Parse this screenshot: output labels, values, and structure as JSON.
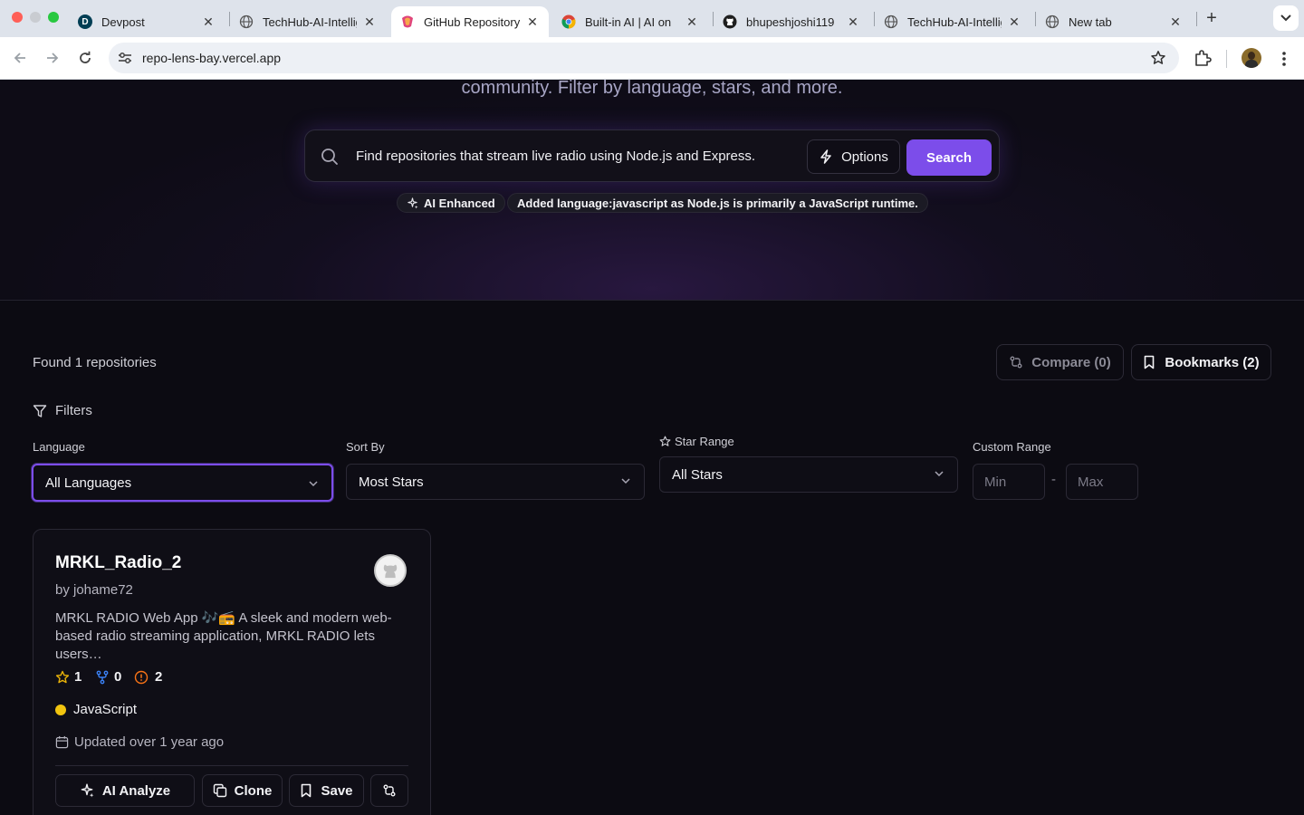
{
  "browser": {
    "tabs": [
      {
        "title": "Devpost",
        "favicon": "devpost-icon"
      },
      {
        "title": "TechHub-AI-Intellig",
        "favicon": "globe-icon"
      },
      {
        "title": "GitHub Repository",
        "favicon": "app-icon",
        "active": true
      },
      {
        "title": "Built-in AI  |  AI on",
        "favicon": "chrome-icon"
      },
      {
        "title": "bhupeshjoshi119",
        "favicon": "github-icon"
      },
      {
        "title": "TechHub-AI-Intellig",
        "favicon": "globe-icon"
      },
      {
        "title": "New tab",
        "favicon": "chrome-icon"
      }
    ],
    "url": "repo-lens-bay.vercel.app"
  },
  "hero": {
    "subtitle": "community. Filter by language, stars, and more.",
    "search_value": "Find repositories that stream live radio using Node.js and Express.",
    "options_label": "Options",
    "search_label": "Search",
    "ai_badge": "AI Enhanced",
    "ai_note": "Added language:javascript as Node.js is primarily a JavaScript runtime."
  },
  "results": {
    "found_text": "Found 1 repositories",
    "compare_label": "Compare (0)",
    "bookmarks_label": "Bookmarks (2)"
  },
  "filters": {
    "title": "Filters",
    "language_label": "Language",
    "language_value": "All Languages",
    "sort_label": "Sort By",
    "sort_value": "Most Stars",
    "star_range_label": "Star Range",
    "star_range_value": "All Stars",
    "custom_range_label": "Custom Range",
    "min_placeholder": "Min",
    "max_placeholder": "Max",
    "range_sep": "-"
  },
  "repo": {
    "name": "MRKL_Radio_2",
    "owner": "by johame72",
    "description": "MRKL RADIO Web App 🎶📻 A sleek and modern web-based radio streaming application, MRKL RADIO lets users…",
    "stars": "1",
    "forks": "0",
    "issues": "2",
    "language": "JavaScript",
    "language_color": "#f1c40f",
    "updated": "Updated over 1 year ago",
    "analyze_label": "AI Analyze",
    "clone_label": "Clone",
    "save_label": "Save"
  },
  "colors": {
    "accent": "#7c4dea",
    "star": "#eab308",
    "fork": "#3b82f6",
    "issue": "#f97316"
  }
}
